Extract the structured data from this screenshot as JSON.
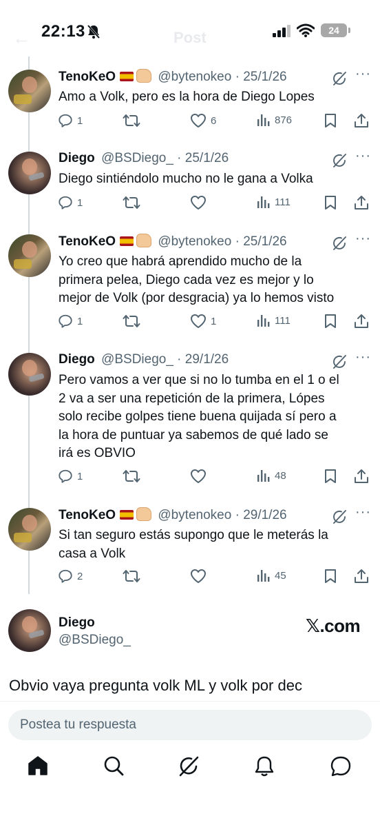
{
  "status_bar": {
    "time": "22:13",
    "battery": "24"
  },
  "header": {
    "title": "Post"
  },
  "thread": [
    {
      "name": "TenoKeO",
      "handle": "@bytenokeo",
      "date": "25/1/26",
      "text_lines": [
        "Amo a Volk, pero es la hora de Diego Lopes"
      ],
      "replies": "1",
      "retweets": "",
      "likes": "6",
      "views": "876"
    },
    {
      "name": "Diego",
      "handle": "@BSDiego_",
      "date": "25/1/26",
      "text_lines": [
        "Diego sintiéndolo mucho no le gana a Volka"
      ],
      "replies": "1",
      "retweets": "",
      "likes": "",
      "views": "111"
    },
    {
      "name": "TenoKeO",
      "handle": "@bytenokeo",
      "date": "25/1/26",
      "text_lines": [
        "Yo creo que habrá aprendido mucho de la",
        "primera pelea, Diego cada vez es mejor y lo",
        "mejor de Volk (por desgracia) ya lo hemos visto"
      ],
      "replies": "1",
      "retweets": "",
      "likes": "1",
      "views": "111"
    },
    {
      "name": "Diego",
      "handle": "@BSDiego_",
      "date": "29/1/26",
      "text_lines": [
        "Pero vamos a ver que si no lo tumba en el 1 o el",
        "2 va a ser una repetición de la primera, Lópes",
        "solo recibe golpes tiene buena quijada sí pero a",
        "la hora de puntuar ya sabemos de qué lado se",
        "irá es OBVIO"
      ],
      "replies": "1",
      "retweets": "",
      "likes": "",
      "views": "48"
    },
    {
      "name": "TenoKeO",
      "handle": "@bytenokeo",
      "date": "29/1/26",
      "text_lines": [
        "Si tan seguro estás supongo que le meterás la",
        "casa a Volk"
      ],
      "replies": "2",
      "retweets": "",
      "likes": "",
      "views": "45"
    }
  ],
  "main_post": {
    "name": "Diego",
    "handle": "@BSDiego_",
    "watermark": "𝕏.com",
    "text": "Obvio vaya pregunta volk ML y volk por dec"
  },
  "reply_input": {
    "placeholder": "Postea tu respuesta"
  },
  "icons": {
    "nav": [
      "home-icon",
      "search-icon",
      "grok-icon",
      "notifications-icon",
      "messages-icon"
    ],
    "actions": [
      "reply-icon",
      "retweet-icon",
      "like-icon",
      "views-icon",
      "bookmark-icon",
      "share-icon"
    ]
  },
  "colors": {
    "text": "#0f1419",
    "secondary": "#536471",
    "thread_line": "#cfd9de",
    "input_bg": "#eff3f4"
  }
}
